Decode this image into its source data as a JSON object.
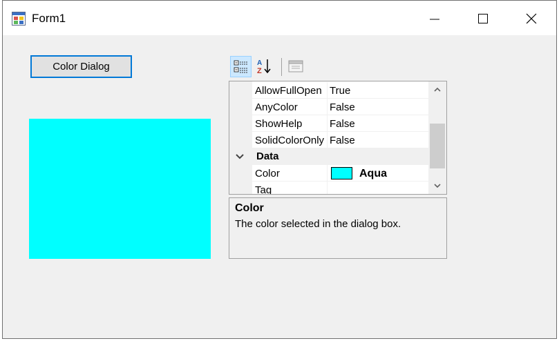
{
  "window": {
    "title": "Form1"
  },
  "form": {
    "color_dialog_button": "Color Dialog",
    "color_panel_color": "#00ffff"
  },
  "property_grid": {
    "toolbar": {
      "categorized_icon": "categorized-icon",
      "alphabetical_icon": "alphabetical-icon",
      "property_pages_icon": "property-pages-icon"
    },
    "rows": [
      {
        "name": "AllowFullOpen",
        "value": "True"
      },
      {
        "name": "AnyColor",
        "value": "False"
      },
      {
        "name": "ShowHelp",
        "value": "False"
      },
      {
        "name": "SolidColorOnly",
        "value": "False"
      }
    ],
    "category": {
      "label": "Data",
      "expanded": true
    },
    "color_row": {
      "name": "Color",
      "value": "Aqua",
      "swatch": "#00ffff"
    },
    "tag_row": {
      "name": "Tag",
      "value": ""
    },
    "help": {
      "title": "Color",
      "description": "The color selected in the dialog box."
    }
  },
  "colors": {
    "accent": "#0078d7",
    "aqua": "#00ffff",
    "form_background": "#f0f0f0"
  }
}
